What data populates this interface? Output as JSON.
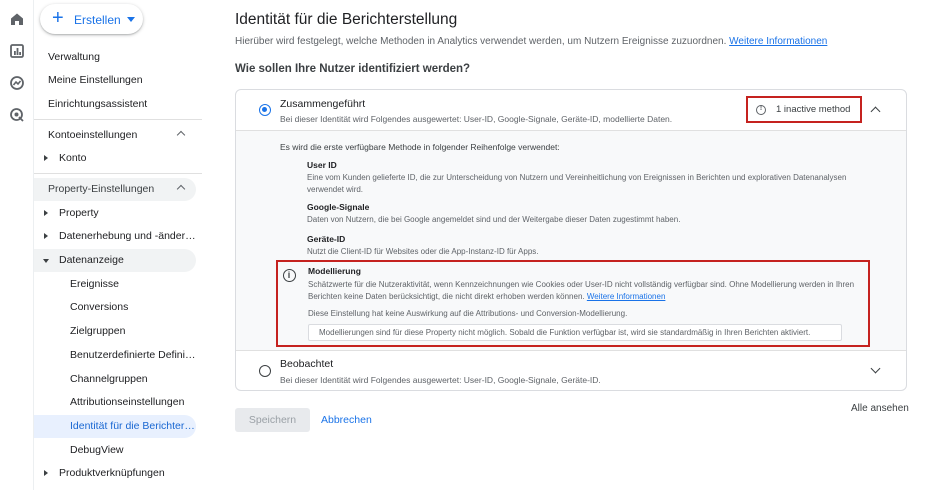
{
  "rail": {
    "icons": [
      "home-icon",
      "reports-icon",
      "explore-icon",
      "advertising-icon"
    ]
  },
  "nav": {
    "create_label": "Erstellen",
    "items": {
      "verwaltung": "Verwaltung",
      "meine_einstellungen": "Meine Einstellungen",
      "einrichtungsassistent": "Einrichtungsassistent",
      "kontoeinstellungen": "Kontoeinstellungen",
      "konto": "Konto",
      "property_einstellungen": "Property-Einstellungen",
      "property": "Property",
      "datenerhebung": "Datenerhebung und -änderu...",
      "datenanzeige": "Datenanzeige",
      "ereignisse": "Ereignisse",
      "conversions": "Conversions",
      "zielgruppen": "Zielgruppen",
      "benutzerdefinierte": "Benutzerdefinierte Definiti...",
      "channelgruppen": "Channelgruppen",
      "attributionseinstellungen": "Attributionseinstellungen",
      "identitaet": "Identität für die Berichters...",
      "debugview": "DebugView",
      "produktverknuepfungen": "Produktverknüpfungen"
    }
  },
  "main": {
    "title": "Identität für die Berichterstellung",
    "subtitle": "Hierüber wird festgelegt, welche Methoden in Analytics verwendet werden, um Nutzern Ereignisse zuzuordnen.",
    "subtitle_link": "Weitere Informationen",
    "question": "Wie sollen Ihre Nutzer identifiziert werden?",
    "option_blended": {
      "title": "Zusammengeführt",
      "desc": "Bei dieser Identität wird Folgendes ausgewertet: User-ID, Google-Signale, Geräte-ID, modellierte Daten.",
      "inactive": "1 inactive method"
    },
    "expanded": {
      "intro": "Es wird die erste verfügbare Methode in folgender Reihenfolge verwendet:",
      "methods": [
        {
          "title": "User ID",
          "desc": "Eine vom Kunden gelieferte ID, die zur Unterscheidung von Nutzern und Vereinheitlichung von Ereignissen in Berichten und explorativen Datenanalysen verwendet wird."
        },
        {
          "title": "Google-Signale",
          "desc": "Daten von Nutzern, die bei Google angemeldet sind und der Weitergabe dieser Daten zugestimmt haben."
        },
        {
          "title": "Geräte-ID",
          "desc": "Nutzt die Client-ID für Websites oder die App-Instanz-ID für Apps."
        }
      ],
      "modeling": {
        "title": "Modellierung",
        "desc": "Schätzwerte für die Nutzeraktivität, wenn Kennzeichnungen wie Cookies oder User-ID nicht vollständig verfügbar sind. Ohne Modellierung werden in Ihren Berichten keine Daten berücksichtigt, die nicht direkt erhoben werden können.",
        "link": "Weitere Informationen",
        "note": "Diese Einstellung hat keine Auswirkung auf die Attributions- und Conversion-Modellierung.",
        "notice": "Modellierungen sind für diese Property nicht möglich. Sobald die Funktion verfügbar ist, wird sie standardmäßig in Ihren Berichten aktiviert."
      }
    },
    "option_observed": {
      "title": "Beobachtet",
      "desc": "Bei dieser Identität wird Folgendes ausgewertet: User-ID, Google-Signale, Geräte-ID."
    },
    "see_all": "Alle ansehen",
    "save": "Speichern",
    "cancel": "Abbrechen"
  },
  "colors": {
    "accent": "#1a73e8",
    "highlight_border": "#c5221f",
    "active_nav_bg": "#e8f0fe"
  }
}
